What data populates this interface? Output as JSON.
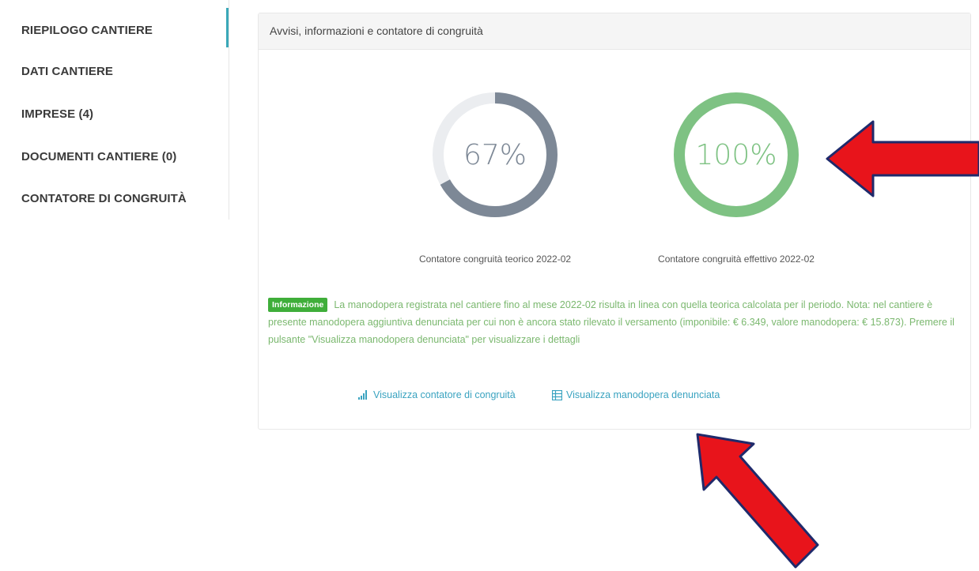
{
  "sidebar": {
    "items": [
      {
        "label": "RIEPILOGO CANTIERE",
        "active": true
      },
      {
        "label": "DATI CANTIERE"
      },
      {
        "label": "IMPRESE (4)"
      },
      {
        "label": "DOCUMENTI CANTIERE (0)"
      },
      {
        "label": "CONTATORE DI CONGRUITÀ"
      }
    ]
  },
  "panel": {
    "title": "Avvisi, informazioni e contatore di congruità",
    "gauges": [
      {
        "label": "67%",
        "value": 0.67,
        "caption": "Contatore congruità teorico 2022-02",
        "color": "#7d8896",
        "track": "#ebedf0"
      },
      {
        "label": "100%",
        "value": 1.0,
        "caption": "Contatore congruità effettivo 2022-02",
        "color": "#7ec283",
        "track": "#e8f4e9"
      }
    ],
    "info": {
      "badge": "Informazione",
      "text": "La manodopera registrata nel cantiere fino al mese 2022-02 risulta in linea con quella teorica calcolata per il periodo. Nota: nel cantiere è presente manodopera aggiuntiva denunciata per cui non è ancora stato rilevato il versamento (imponibile: € 6.349, valore manodopera: € 15.873). Premere il pulsante \"Visualizza manodopera denunciata\" per visualizzare i dettagli"
    },
    "links": {
      "contatore": "Visualizza contatore di congruità",
      "manodopera": "Visualizza manodopera denunciata"
    }
  },
  "colors": {
    "accent": "#3aa8b8",
    "link": "#3aa3c0",
    "info_text": "#7bb86f",
    "badge_bg": "#3fae3a",
    "arrow": "#e8141b"
  },
  "icons": [
    "bar-chart-icon",
    "table-icon",
    "red-arrow-left",
    "red-arrow-up-left"
  ]
}
